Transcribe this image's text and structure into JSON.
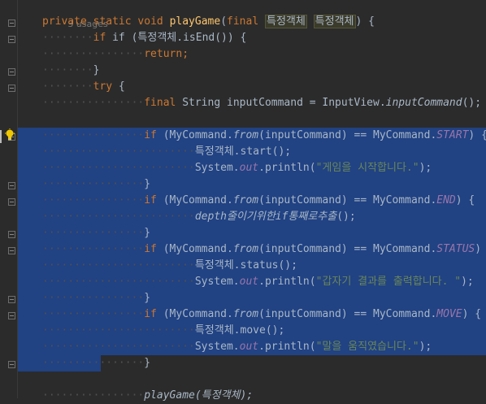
{
  "usages": "3 usages",
  "code": {
    "sig_private": "private",
    "sig_static": "static",
    "sig_void": "void",
    "sig_name": "playGame",
    "sig_final": "final",
    "sig_type": "특정객체",
    "sig_param": "특정객체",
    "if_isend": "if (특정객체.isEnd()) {",
    "ret": "return;",
    "close1": "}",
    "try": "try",
    "final_kw": "final",
    "input_decl": "String inputCommand = InputView.",
    "input_call": "inputCommand",
    "input_end": "();",
    "if1_pre": "if (MyCommand.",
    "from": "from",
    "if_mid": "(inputCommand) == MyCommand.",
    "start": "START",
    "if_end": ") {",
    "start_call": "특정객체.start();",
    "sysout_pre": "System.",
    "out": "out",
    "println": ".println(",
    "msg_start": "\"게임을 시작합니다.\"",
    "close_paren": ");",
    "close_brace": "}",
    "end": "END",
    "depth_call": "depth줄이기위한if통째로추출",
    "depth_paren": "();",
    "status": "STATUS",
    "status_call": "특정객체.status();",
    "msg_status": "\"갑자기 결과를 출력합니다. \"",
    "move": "MOVE",
    "move_call": "특정객체.move();",
    "msg_move": "\"말을 움직였습니다.\"",
    "play_call": "playGame(특정객체);"
  },
  "icons": {
    "bulb": "lightbulb-icon",
    "fold": "fold-marker-icon"
  },
  "colors": {
    "background": "#2b2b2b",
    "selection": "#214283",
    "keyword": "#cc7832",
    "method": "#ffc66d",
    "string": "#6a8759",
    "field": "#9876aa"
  }
}
